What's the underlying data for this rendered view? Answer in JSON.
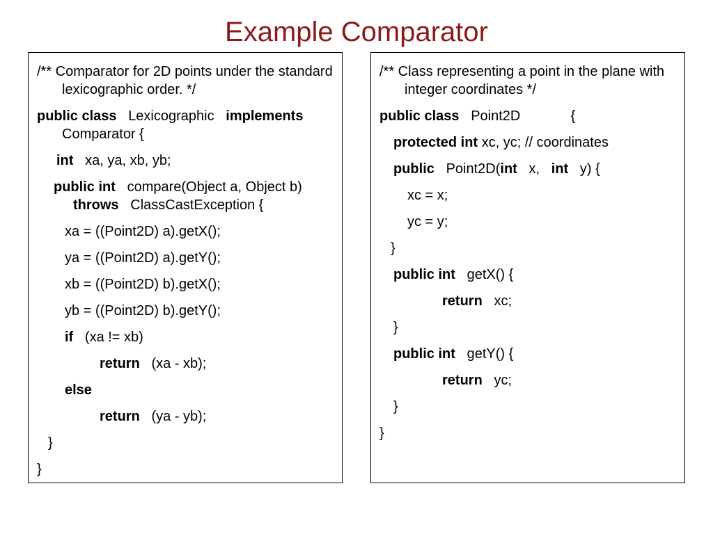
{
  "title": "Example Comparator",
  "left": {
    "c1a": "/** Comparator for 2D points under the",
    "c1b": "standard lexicographic order. */",
    "k_pubclass": "public class",
    "name_lexi": "Lexicographic",
    "k_implements": "implements",
    "name_comp": "Comparator  {",
    "k_int": "int",
    "vars": "xa, ya, xb, yb;",
    "k_pubint": "public int",
    "sig_compare": "compare(Object a, Object b)",
    "k_throws": "throws",
    "throws_rest": "ClassCastException  {",
    "l_xa": "xa = ((Point2D) a).getX();",
    "l_ya": "ya = ((Point2D) a).getY();",
    "l_xb": "xb = ((Point2D) b).getX();",
    "l_yb": "yb = ((Point2D) b).getY();",
    "k_if": "if",
    "cond": "(xa != xb)",
    "k_return1": "return",
    "ret1": "(xa - xb);",
    "k_else": "else",
    "k_return2": "return",
    "ret2": "(ya - yb);",
    "close1": "}",
    "close2": "}"
  },
  "right": {
    "c1a": "/** Class representing a point in the",
    "c1b": "plane with integer coordinates */",
    "k_pubclass": "public class",
    "name_pt": "Point2D",
    "brace": "{",
    "k_protint": "protected int",
    "fields": "xc, yc; // coordinates",
    "k_public": "public",
    "ctor_a": "Point2D(",
    "k_int1": "int",
    "ctor_b": "x,",
    "k_int2": "int",
    "ctor_c": "y)  {",
    "l_xc": "xc = x;",
    "l_yc": "yc = y;",
    "close_ctor": "}",
    "k_pubint_gx": "public int",
    "getx": "getX()  {",
    "k_return_x": "return",
    "ret_x": "xc;",
    "close_gx": "}",
    "k_pubint_gy": "public int",
    "gety": "getY()  {",
    "k_return_y": "return",
    "ret_y": "yc;",
    "close_gy": "}",
    "close_class": "}"
  }
}
